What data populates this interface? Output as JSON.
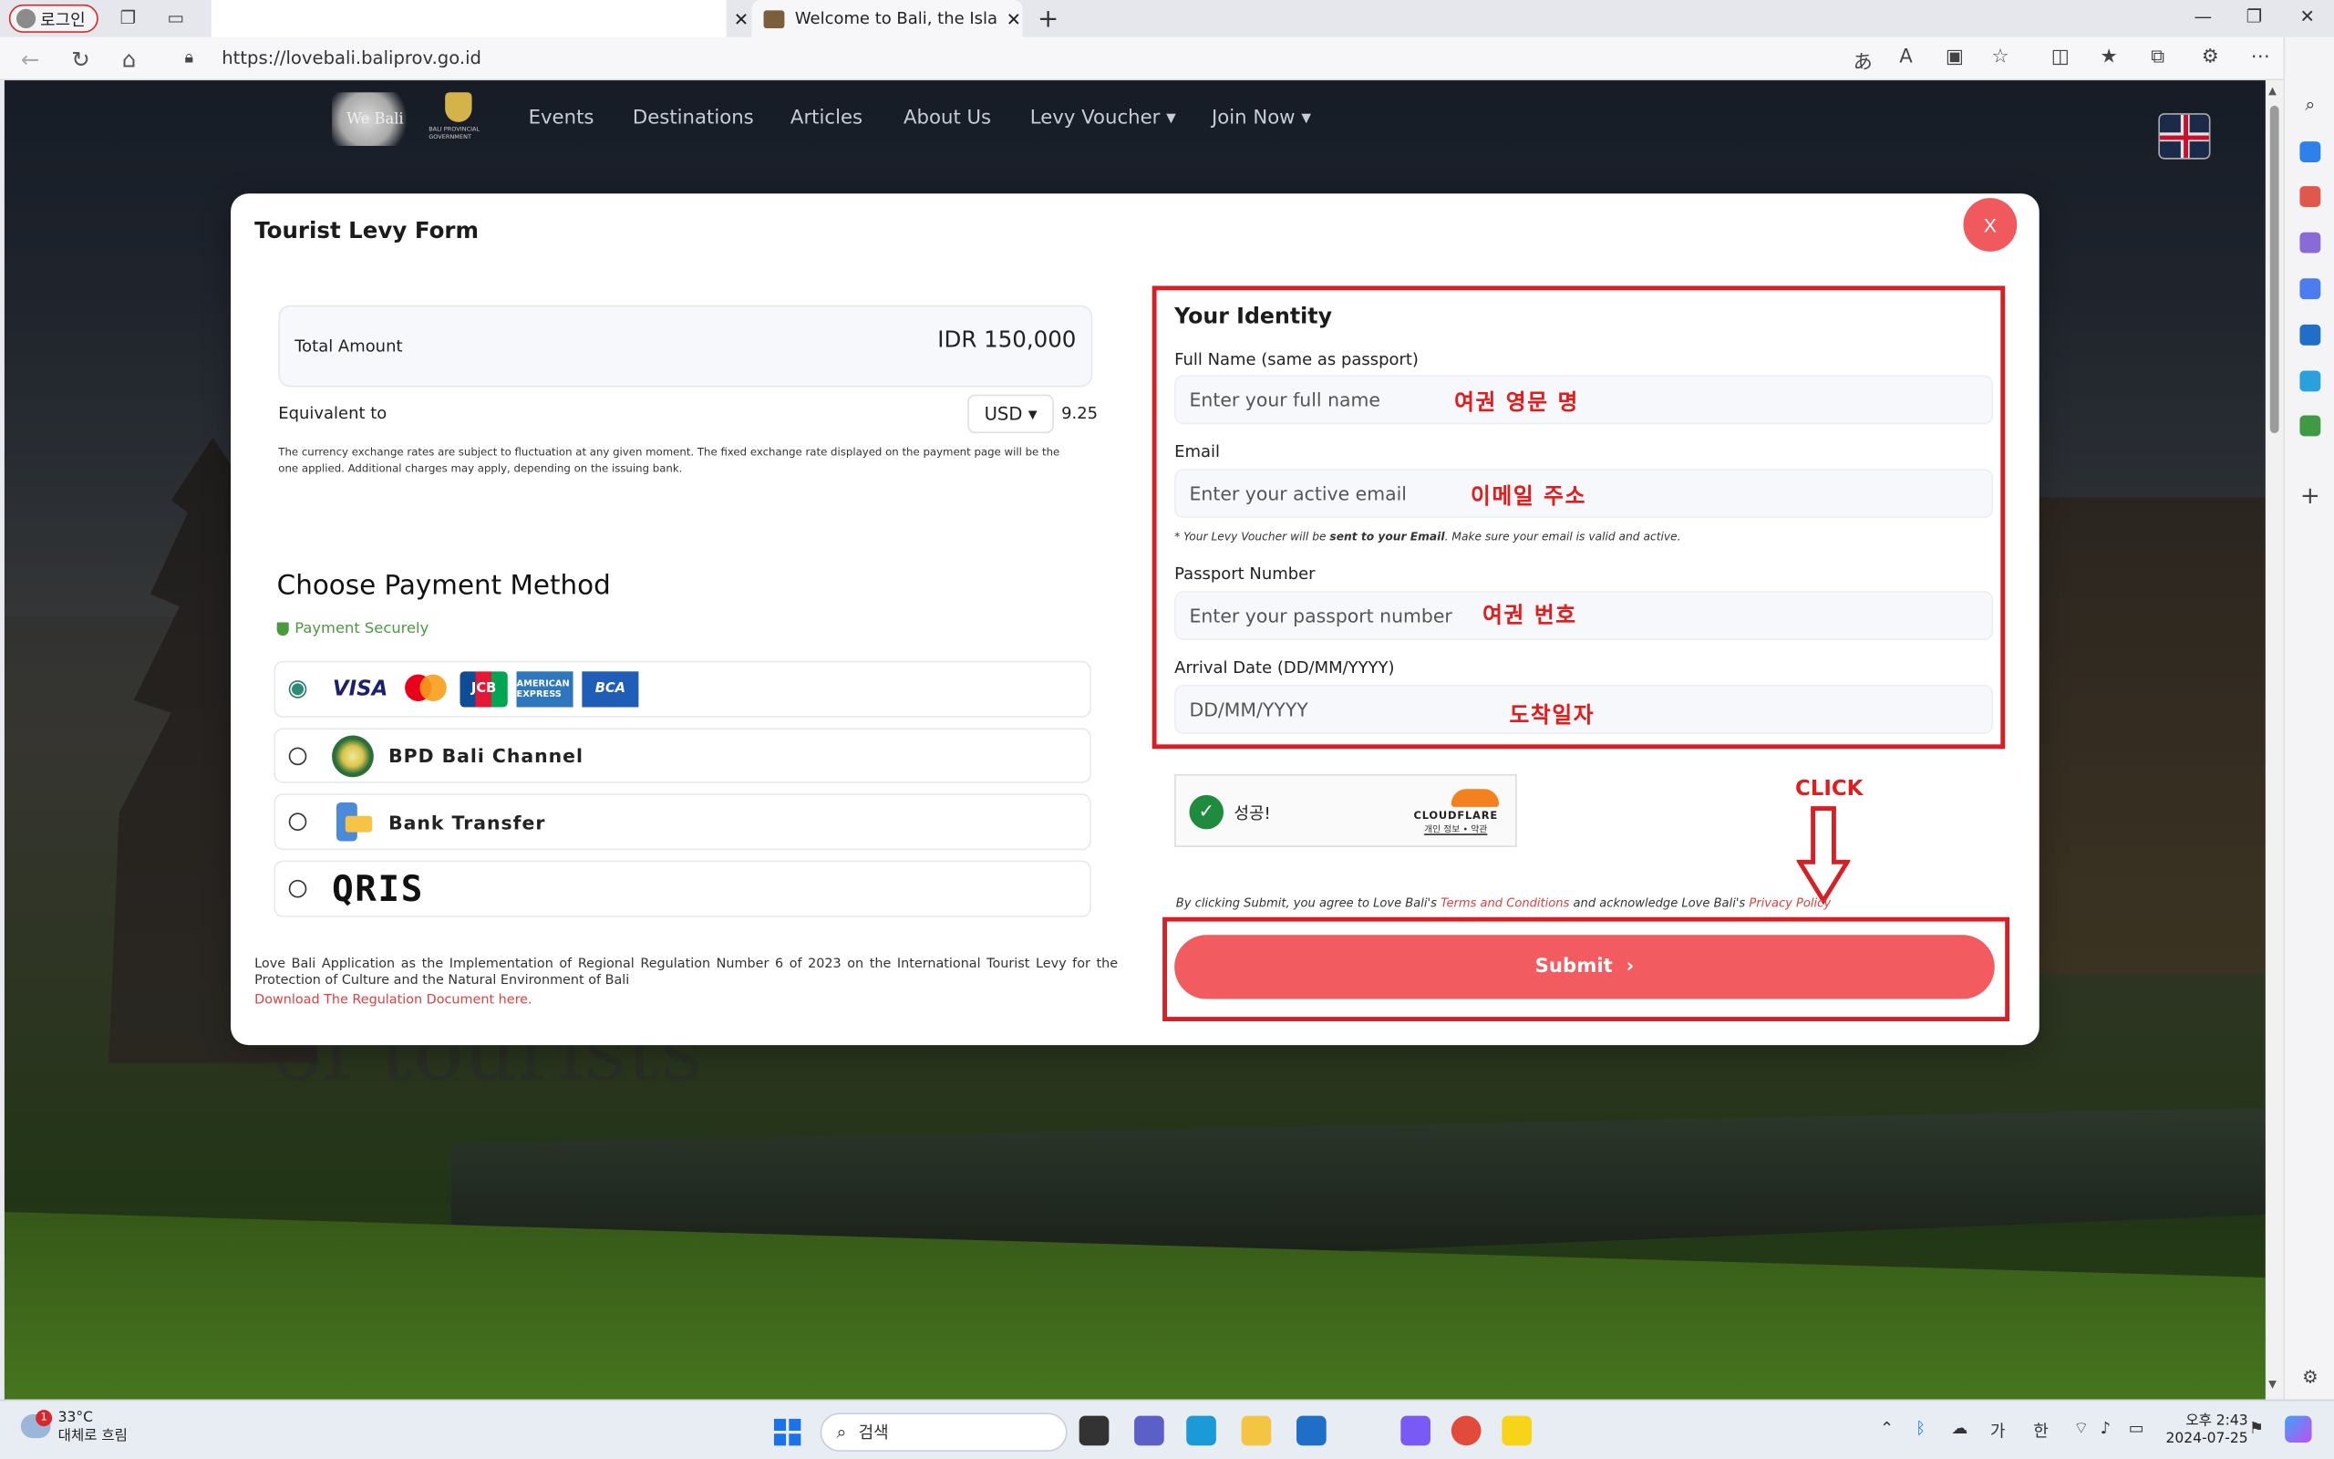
{
  "browser": {
    "profile_label": "로그인",
    "blank_tab_title": "",
    "active_tab_title": "Welcome to Bali, the Island of Gods",
    "url": "https://lovebali.baliprov.go.id"
  },
  "site_nav": {
    "logo_text": "We Bali",
    "gov_text": "BALI PROVINCIAL GOVERNMENT",
    "items": [
      "Events",
      "Destinations",
      "Articles",
      "About Us",
      "Levy Voucher",
      "Join Now"
    ]
  },
  "background_text": "of tourists",
  "modal": {
    "title": "Tourist Levy Form",
    "close_label": "X",
    "total_label": "Total Amount",
    "total_amount": "IDR 150,000",
    "equivalent_label": "Equivalent to",
    "currency": "USD",
    "equivalent_value": "9.25",
    "disclaimer": "The currency exchange rates are subject to fluctuation at any given moment. The fixed exchange rate displayed on the payment page will be the one applied. Additional charges may apply, depending on the issuing bank.",
    "payment_title": "Choose Payment Method",
    "payment_secure": "Payment Securely",
    "card_logos": {
      "visa": "VISA",
      "jcb": "JCB",
      "amex": "AMERICAN EXPRESS",
      "bca": "BCA"
    },
    "payment_options": [
      "BPD Bali Channel",
      "Bank Transfer",
      "QRIS"
    ],
    "regulation_text": "Love Bali Application as the Implementation of Regional Regulation Number 6 of 2023 on the International Tourist Levy for the Protection of Culture and the Natural Environment of Bali",
    "regulation_link": "Download The Regulation Document here.",
    "identity": {
      "title": "Your Identity",
      "full_name_label": "Full Name (same as passport)",
      "full_name_placeholder": "Enter your full name",
      "email_label": "Email",
      "email_placeholder": "Enter your active email",
      "email_note_pre": "* Your Levy Voucher will be ",
      "email_note_bold": "sent to your Email",
      "email_note_post": ". Make sure your email is valid and active.",
      "passport_label": "Passport Number",
      "passport_placeholder": "Enter your passport number",
      "arrival_label": "Arrival Date (DD/MM/YYYY)",
      "arrival_placeholder": "DD/MM/YYYY"
    },
    "annotations": {
      "name": "여권 영문 명",
      "email": "이메일 주소",
      "passport": "여권 번호",
      "arrival": "도착일자",
      "click": "CLICK"
    },
    "captcha": {
      "status": "성공!",
      "brand": "CLOUDFLARE",
      "links": "개인 정보 • 약관"
    },
    "agree": {
      "pre": "By clicking Submit, you agree to Love Bali's ",
      "terms": "Terms and Conditions",
      "mid": " and acknowledge Love Bali's ",
      "privacy": "Privacy Policy"
    },
    "submit_label": "Submit"
  },
  "taskbar": {
    "temperature": "33°C",
    "weather": "대체로 흐림",
    "weather_badge": "1",
    "search_label": "검색",
    "ime1": "가",
    "ime2": "한",
    "time": "오후 2:43",
    "date": "2024-07-25"
  },
  "colors": {
    "accent": "#f25b5f",
    "annotation_red": "#d91f26",
    "secure_green": "#4a9a3e"
  }
}
